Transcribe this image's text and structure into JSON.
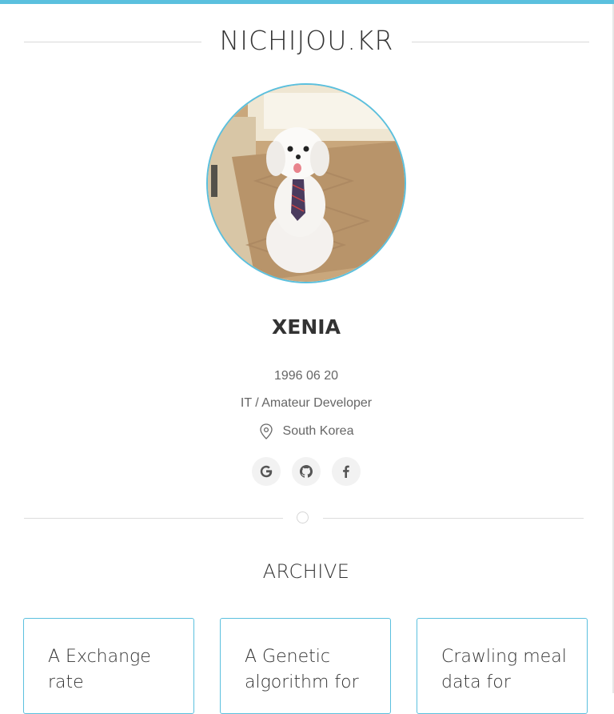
{
  "site": {
    "title": "NICHIJOU.KR",
    "accent_color": "#5bc0de"
  },
  "profile": {
    "avatar": "dog-wearing-tie-photo",
    "name": "XENIA",
    "birthday": "1996 06 20",
    "job": "IT / Amateur Developer",
    "location": "South Korea"
  },
  "social": [
    {
      "icon": "google-icon"
    },
    {
      "icon": "github-icon"
    },
    {
      "icon": "facebook-icon"
    }
  ],
  "archive": {
    "title": "ARCHIVE",
    "cards": [
      {
        "title": "A Exchange rate"
      },
      {
        "title": "A Genetic algorithm for"
      },
      {
        "title": "Crawling meal data for"
      }
    ]
  }
}
